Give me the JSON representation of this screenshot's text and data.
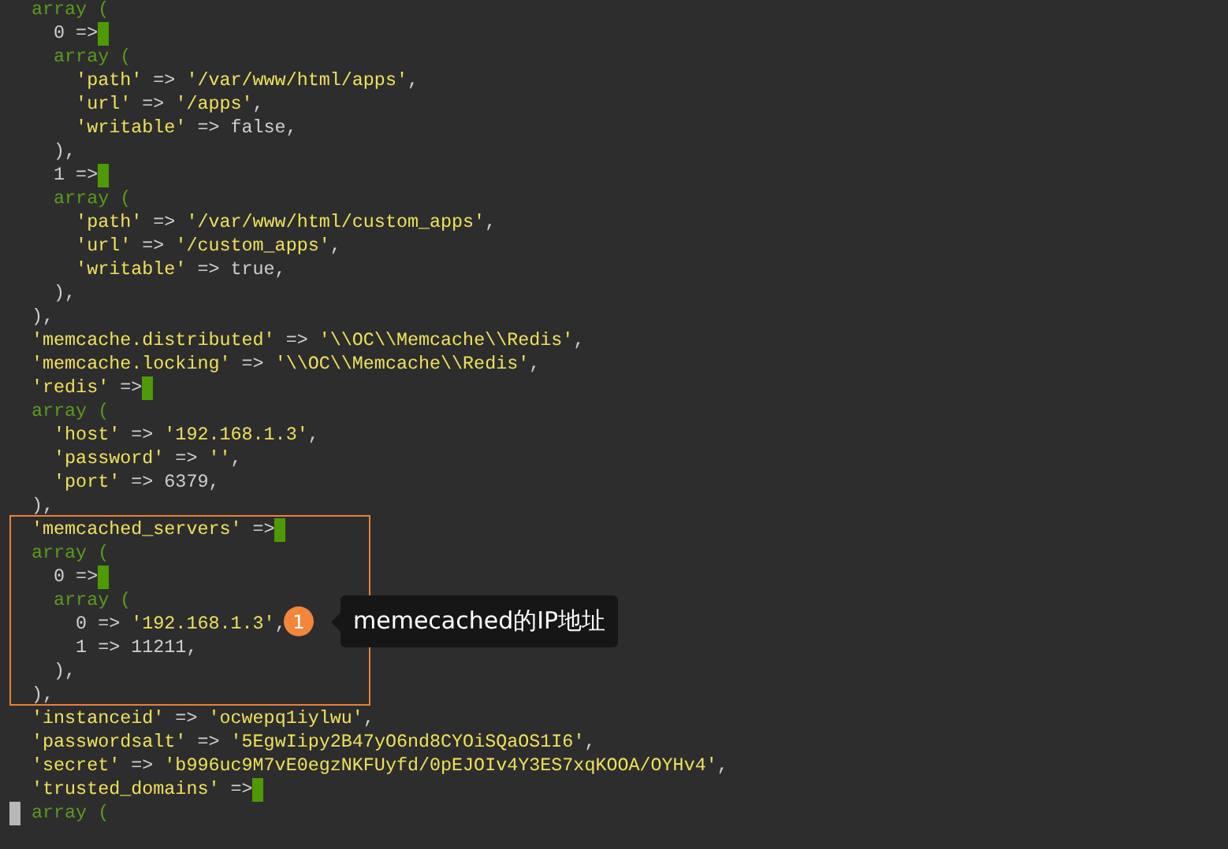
{
  "lines": [
    {
      "parts": [
        {
          "t": "array (",
          "kind": "kw"
        }
      ]
    },
    {
      "parts": [
        {
          "t": "  0 =>",
          "kind": "plain"
        }
      ],
      "cursor": true
    },
    {
      "parts": [
        {
          "t": "  array (",
          "kind": "kw"
        }
      ]
    },
    {
      "parts": [
        {
          "t": "    'path'",
          "kind": "str"
        },
        {
          "t": " => ",
          "kind": "plain"
        },
        {
          "t": "'/var/www/html/apps'",
          "kind": "str"
        },
        {
          "t": ",",
          "kind": "plain"
        }
      ]
    },
    {
      "parts": [
        {
          "t": "    'url'",
          "kind": "str"
        },
        {
          "t": " => ",
          "kind": "plain"
        },
        {
          "t": "'/apps'",
          "kind": "str"
        },
        {
          "t": ",",
          "kind": "plain"
        }
      ]
    },
    {
      "parts": [
        {
          "t": "    'writable'",
          "kind": "str"
        },
        {
          "t": " => false,",
          "kind": "plain"
        }
      ]
    },
    {
      "parts": [
        {
          "t": "  ),",
          "kind": "plain"
        }
      ]
    },
    {
      "parts": [
        {
          "t": "  1 =>",
          "kind": "plain"
        }
      ],
      "cursor": true
    },
    {
      "parts": [
        {
          "t": "  array (",
          "kind": "kw"
        }
      ]
    },
    {
      "parts": [
        {
          "t": "    'path'",
          "kind": "str"
        },
        {
          "t": " => ",
          "kind": "plain"
        },
        {
          "t": "'/var/www/html/custom_apps'",
          "kind": "str"
        },
        {
          "t": ",",
          "kind": "plain"
        }
      ]
    },
    {
      "parts": [
        {
          "t": "    'url'",
          "kind": "str"
        },
        {
          "t": " => ",
          "kind": "plain"
        },
        {
          "t": "'/custom_apps'",
          "kind": "str"
        },
        {
          "t": ",",
          "kind": "plain"
        }
      ]
    },
    {
      "parts": [
        {
          "t": "    'writable'",
          "kind": "str"
        },
        {
          "t": " => true,",
          "kind": "plain"
        }
      ]
    },
    {
      "parts": [
        {
          "t": "  ),",
          "kind": "plain"
        }
      ]
    },
    {
      "parts": [
        {
          "t": "),",
          "kind": "plain"
        }
      ]
    },
    {
      "parts": [
        {
          "t": "'memcache.distributed'",
          "kind": "str"
        },
        {
          "t": " => ",
          "kind": "plain"
        },
        {
          "t": "'\\\\OC\\\\Memcache\\\\Redis'",
          "kind": "str"
        },
        {
          "t": ",",
          "kind": "plain"
        }
      ]
    },
    {
      "parts": [
        {
          "t": "'memcache.locking'",
          "kind": "str"
        },
        {
          "t": " => ",
          "kind": "plain"
        },
        {
          "t": "'\\\\OC\\\\Memcache\\\\Redis'",
          "kind": "str"
        },
        {
          "t": ",",
          "kind": "plain"
        }
      ]
    },
    {
      "parts": [
        {
          "t": "'redis'",
          "kind": "str"
        },
        {
          "t": " =>",
          "kind": "plain"
        }
      ],
      "cursor": true
    },
    {
      "parts": [
        {
          "t": "array (",
          "kind": "kw"
        }
      ]
    },
    {
      "parts": [
        {
          "t": "  'host'",
          "kind": "str"
        },
        {
          "t": " => ",
          "kind": "plain"
        },
        {
          "t": "'192.168.1.3'",
          "kind": "str"
        },
        {
          "t": ",",
          "kind": "plain"
        }
      ]
    },
    {
      "parts": [
        {
          "t": "  'password'",
          "kind": "str"
        },
        {
          "t": " => ",
          "kind": "plain"
        },
        {
          "t": "''",
          "kind": "str"
        },
        {
          "t": ",",
          "kind": "plain"
        }
      ]
    },
    {
      "parts": [
        {
          "t": "  'port'",
          "kind": "str"
        },
        {
          "t": " => 6379,",
          "kind": "plain"
        }
      ]
    },
    {
      "parts": [
        {
          "t": "),",
          "kind": "plain"
        }
      ]
    },
    {
      "parts": [
        {
          "t": "'memcached_servers'",
          "kind": "str"
        },
        {
          "t": " =>",
          "kind": "plain"
        }
      ],
      "cursor": true
    },
    {
      "parts": [
        {
          "t": "array (",
          "kind": "kw"
        }
      ]
    },
    {
      "parts": [
        {
          "t": "  0 =>",
          "kind": "plain"
        }
      ],
      "cursor": true
    },
    {
      "parts": [
        {
          "t": "  array (",
          "kind": "kw"
        }
      ]
    },
    {
      "parts": [
        {
          "t": "    0 => ",
          "kind": "plain"
        },
        {
          "t": "'192.168.1.3'",
          "kind": "str"
        },
        {
          "t": ",",
          "kind": "plain"
        }
      ]
    },
    {
      "parts": [
        {
          "t": "    1 => 11211,",
          "kind": "plain"
        }
      ]
    },
    {
      "parts": [
        {
          "t": "  ),",
          "kind": "plain"
        }
      ]
    },
    {
      "parts": [
        {
          "t": "),",
          "kind": "plain"
        }
      ]
    },
    {
      "parts": [
        {
          "t": "'instanceid'",
          "kind": "str"
        },
        {
          "t": " => ",
          "kind": "plain"
        },
        {
          "t": "'ocwepq1iylwu'",
          "kind": "str"
        },
        {
          "t": ",",
          "kind": "plain"
        }
      ]
    },
    {
      "parts": [
        {
          "t": "'passwordsalt'",
          "kind": "str"
        },
        {
          "t": " => ",
          "kind": "plain"
        },
        {
          "t": "'5EgwIipy2B47yO6nd8CYOiSQaOS1I6'",
          "kind": "str"
        },
        {
          "t": ",",
          "kind": "plain"
        }
      ]
    },
    {
      "parts": [
        {
          "t": "'secret'",
          "kind": "str"
        },
        {
          "t": " => ",
          "kind": "plain"
        },
        {
          "t": "'b996uc9M7vE0egzNKFUyfd/0pEJOIv4Y3ES7xqKOOA/OYHv4'",
          "kind": "str"
        },
        {
          "t": ",",
          "kind": "plain"
        }
      ]
    },
    {
      "parts": [
        {
          "t": "'trusted_domains'",
          "kind": "str"
        },
        {
          "t": " =>",
          "kind": "plain"
        }
      ],
      "cursor": true
    },
    {
      "parts": [
        {
          "t": "array (",
          "kind": "kw"
        }
      ],
      "marker": true
    }
  ],
  "annotation": {
    "badge": "1",
    "text": "memecached的IP地址"
  }
}
